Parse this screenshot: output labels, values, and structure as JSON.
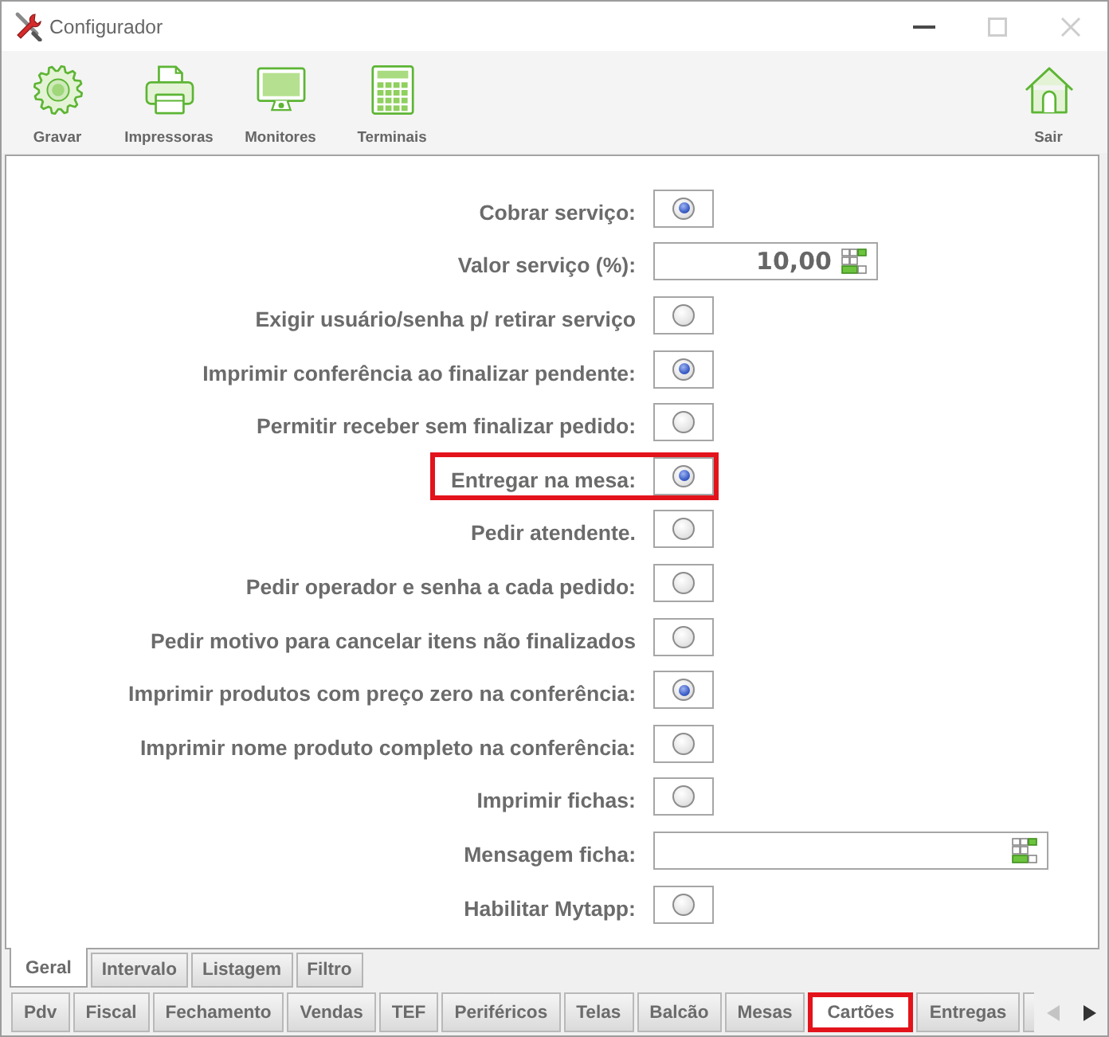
{
  "window": {
    "title": "Configurador",
    "controls": [
      {
        "kind": "minimize",
        "disabled": false
      },
      {
        "kind": "maximize",
        "disabled": true
      },
      {
        "kind": "close",
        "disabled": true
      }
    ]
  },
  "toolbar": {
    "buttons": [
      {
        "label": "Gravar",
        "kind": "gear"
      },
      {
        "label": "Impressoras",
        "kind": "printer"
      },
      {
        "label": "Monitores",
        "kind": "monitor"
      },
      {
        "label": "Terminais",
        "kind": "calculator"
      }
    ],
    "exit_button": {
      "label": "Sair",
      "kind": "house"
    }
  },
  "settings": [
    {
      "label": "Cobrar serviço:",
      "kind": "radio",
      "checked": true,
      "highlighted": false
    },
    {
      "label": "Valor serviço (%):",
      "kind": "number",
      "value": "10,00",
      "highlighted": false
    },
    {
      "label": "Exigir usuário/senha p/ retirar serviço",
      "kind": "radio",
      "checked": false,
      "highlighted": false
    },
    {
      "label": "Imprimir conferência ao finalizar pendente:",
      "kind": "radio",
      "checked": true,
      "highlighted": false
    },
    {
      "label": "Permitir receber sem finalizar pedido:",
      "kind": "radio",
      "checked": false,
      "highlighted": false
    },
    {
      "label": "Entregar na mesa:",
      "kind": "radio",
      "checked": true,
      "highlighted": true
    },
    {
      "label": "Pedir atendente.",
      "kind": "radio",
      "checked": false,
      "highlighted": false
    },
    {
      "label": "Pedir operador e senha a cada pedido:",
      "kind": "radio",
      "checked": false,
      "highlighted": false
    },
    {
      "label": "Pedir motivo para cancelar itens não finalizados",
      "kind": "radio",
      "checked": false,
      "highlighted": false
    },
    {
      "label": "Imprimir produtos com preço zero na conferência:",
      "kind": "radio",
      "checked": true,
      "highlighted": false
    },
    {
      "label": "Imprimir nome produto completo na conferência:",
      "kind": "radio",
      "checked": false,
      "highlighted": false
    },
    {
      "label": "Imprimir fichas:",
      "kind": "radio",
      "checked": false,
      "highlighted": false
    },
    {
      "label": "Mensagem ficha:",
      "kind": "text",
      "highlighted": false
    },
    {
      "label": "Habilitar Mytapp:",
      "kind": "radio",
      "checked": false,
      "highlighted": false
    }
  ],
  "sub_tabs": [
    {
      "label": "Geral",
      "selected": true
    },
    {
      "label": "Intervalo",
      "selected": false
    },
    {
      "label": "Listagem",
      "selected": false
    },
    {
      "label": "Filtro",
      "selected": false
    }
  ],
  "tabs": [
    {
      "label": "Pdv",
      "selected": false,
      "highlighted": false
    },
    {
      "label": "Fiscal",
      "selected": false,
      "highlighted": false
    },
    {
      "label": "Fechamento",
      "selected": false,
      "highlighted": false
    },
    {
      "label": "Vendas",
      "selected": false,
      "highlighted": false
    },
    {
      "label": "TEF",
      "selected": false,
      "highlighted": false
    },
    {
      "label": "Periféricos",
      "selected": false,
      "highlighted": false
    },
    {
      "label": "Telas",
      "selected": false,
      "highlighted": false
    },
    {
      "label": "Balcão",
      "selected": false,
      "highlighted": false
    },
    {
      "label": "Mesas",
      "selected": false,
      "highlighted": false
    },
    {
      "label": "Cartões",
      "selected": true,
      "highlighted": true
    },
    {
      "label": "Entregas",
      "selected": false,
      "highlighted": false
    }
  ],
  "tab_scroll": [
    {
      "kind": "left",
      "disabled": true
    },
    {
      "kind": "right",
      "disabled": false
    }
  ]
}
